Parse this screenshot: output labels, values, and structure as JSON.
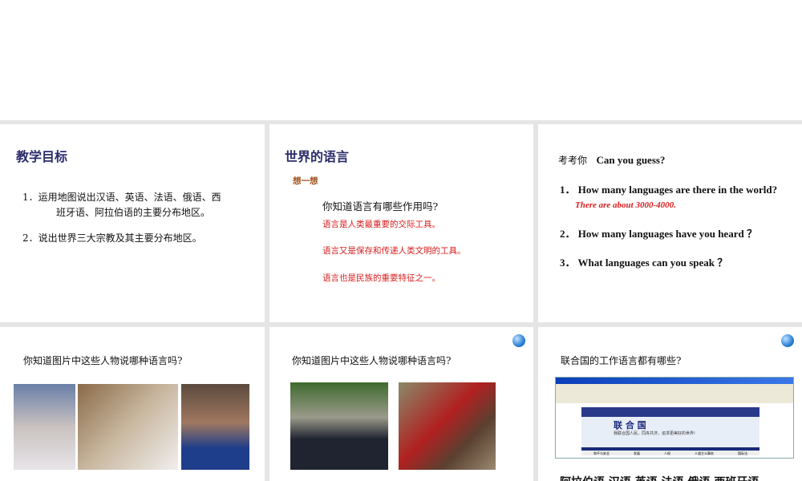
{
  "slides": [
    {
      "title": "教学目标",
      "items": [
        "1．运用地图说出汉语、英语、法语、俄语、西",
        "班牙语、阿拉伯语的主要分布地区。",
        "2．说出世界三大宗教及其主要分布地区。"
      ]
    },
    {
      "title": "世界的语言",
      "subtitle": "想一想",
      "question": "你知道语言有哪些作用吗?",
      "answers": [
        "语言是人类最重要的交际工具。",
        "语言又是保存和传递人类文明的工具。",
        "语言也是民族的重要特征之一。"
      ]
    },
    {
      "heading_cn": "考考你",
      "heading_en": "Can you guess?",
      "questions": [
        "1．  How many languages are there in the world?",
        "2．  How many languages have you heard ？",
        "3．  What languages can you speak ？"
      ],
      "answer": "There are about 3000-4000."
    },
    {
      "question": "你知道图片中这些人物说哪种语言吗?"
    },
    {
      "question": "你知道图片中这些人物说哪种语言吗?"
    },
    {
      "question": "联合国的工作语言都有哪些?",
      "languages": "阿拉伯语  汉语  英语  法语  俄语  西班牙语",
      "browser": {
        "site_title": "联 合 国",
        "tagline": "我联合国人民，同舟共济，追求更美好的世界!",
        "nav": [
          "和平与安全",
          "发展",
          "人权",
          "人道主义事务",
          "国际法"
        ]
      }
    }
  ]
}
